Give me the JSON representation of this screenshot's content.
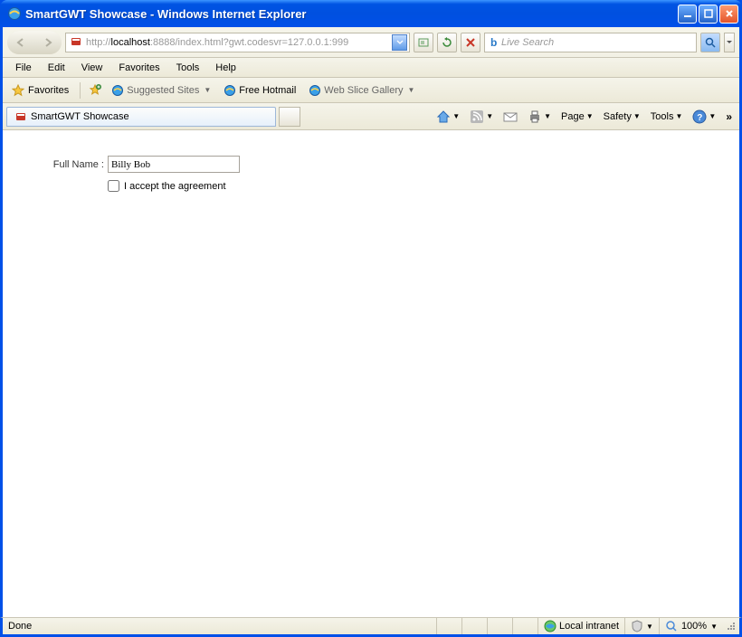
{
  "window": {
    "title": "SmartGWT Showcase - Windows Internet Explorer"
  },
  "address": {
    "prefix": "http://",
    "host": "localhost",
    "rest": ":8888/index.html?gwt.codesvr=127.0.0.1:999"
  },
  "search": {
    "placeholder": "Live Search"
  },
  "menu": {
    "file": "File",
    "edit": "Edit",
    "view": "View",
    "favorites": "Favorites",
    "tools": "Tools",
    "help": "Help"
  },
  "favbar": {
    "favorites": "Favorites",
    "suggested": "Suggested Sites",
    "hotmail": "Free Hotmail",
    "slice": "Web Slice Gallery"
  },
  "tab": {
    "title": "SmartGWT Showcase"
  },
  "commandbar": {
    "page": "Page",
    "safety": "Safety",
    "tools": "Tools"
  },
  "form": {
    "fullname_label": "Full Name :",
    "fullname_value": "Billy Bob",
    "accept_label": "I accept the agreement"
  },
  "status": {
    "done": "Done",
    "zone": "Local intranet",
    "zoom": "100%"
  }
}
